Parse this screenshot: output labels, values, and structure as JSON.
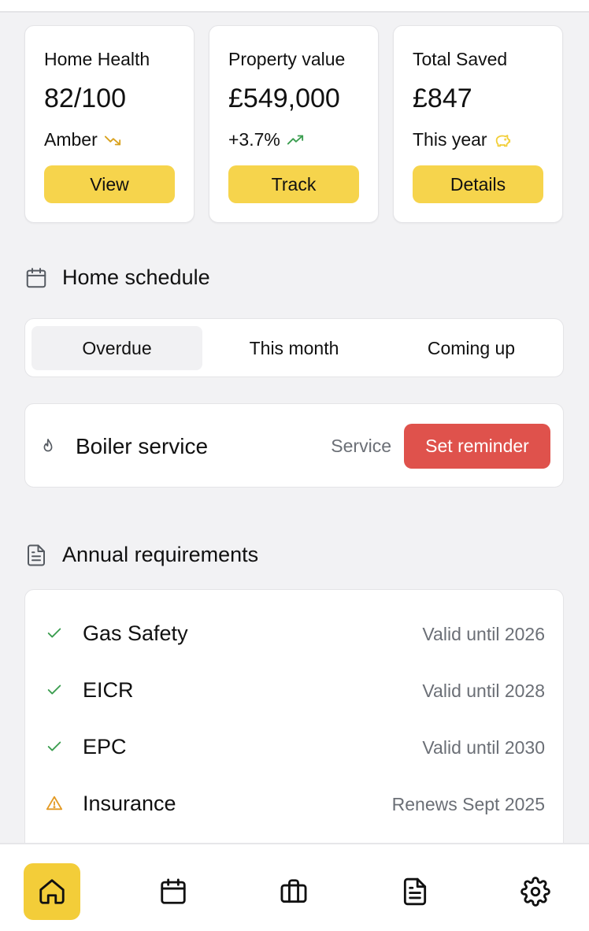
{
  "stats": [
    {
      "label": "Home Health",
      "value": "82/100",
      "sub": "Amber",
      "sub_icon": "trending-down-icon",
      "button": "View"
    },
    {
      "label": "Property value",
      "value": "£549,000",
      "sub": "+3.7%",
      "sub_icon": "trending-up-icon",
      "button": "Track"
    },
    {
      "label": "Total Saved",
      "value": "£847",
      "sub": "This year",
      "sub_icon": "piggy-bank-icon",
      "button": "Details"
    }
  ],
  "schedule": {
    "title": "Home schedule",
    "tabs": [
      "Overdue",
      "This month",
      "Coming up"
    ],
    "active_tab": "Overdue",
    "task": {
      "name": "Boiler service",
      "type": "Service",
      "action": "Set reminder"
    }
  },
  "requirements": {
    "title": "Annual requirements",
    "items": [
      {
        "name": "Gas Safety",
        "status": "Valid until 2026",
        "state": "ok"
      },
      {
        "name": "EICR",
        "status": "Valid until 2028",
        "state": "ok"
      },
      {
        "name": "EPC",
        "status": "Valid until 2030",
        "state": "ok"
      },
      {
        "name": "Insurance",
        "status": "Renews Sept 2025",
        "state": "warning"
      }
    ]
  },
  "nav": [
    "home-icon",
    "calendar-icon",
    "briefcase-icon",
    "document-icon",
    "settings-icon"
  ],
  "colors": {
    "accent": "#f6d44c",
    "danger": "#df524c",
    "ok": "#3a9d4f",
    "warning": "#e39a24",
    "trend_down": "#d9a21f"
  }
}
